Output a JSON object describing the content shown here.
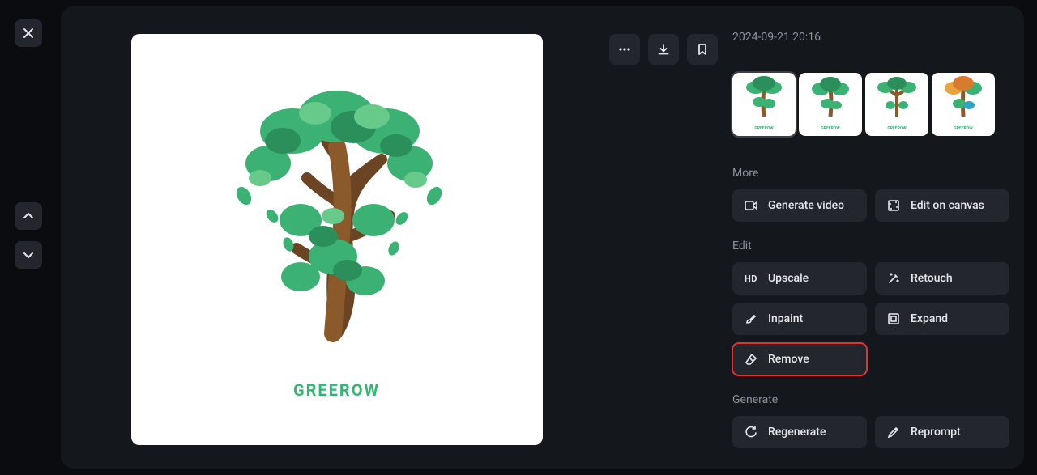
{
  "timestamp": "2024-09-21 20:16",
  "main_image": {
    "caption": "GREEROW"
  },
  "thumbs": [
    {
      "caption": "GREEROW"
    },
    {
      "caption": "GREEROW"
    },
    {
      "caption": "GREEROW"
    },
    {
      "caption": "GREEROW"
    }
  ],
  "sections": {
    "more_label": "More",
    "edit_label": "Edit",
    "generate_label": "Generate"
  },
  "buttons": {
    "generate_video": "Generate video",
    "edit_on_canvas": "Edit on canvas",
    "upscale": "Upscale",
    "upscale_prefix": "HD",
    "retouch": "Retouch",
    "inpaint": "Inpaint",
    "expand": "Expand",
    "remove": "Remove",
    "regenerate": "Regenerate",
    "reprompt": "Reprompt"
  }
}
